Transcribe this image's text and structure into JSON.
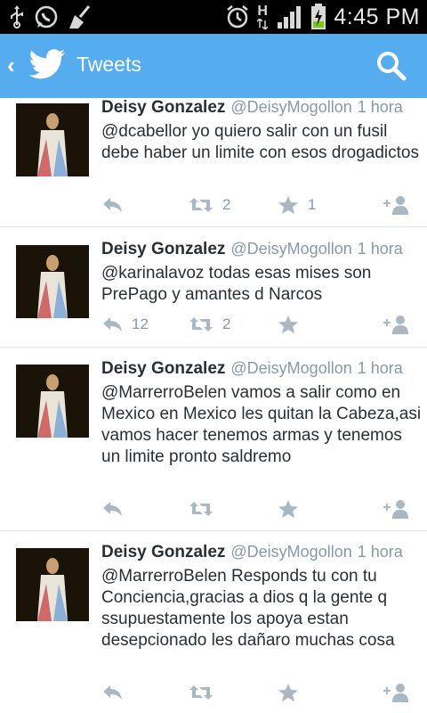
{
  "status_bar": {
    "time": "4:45 PM",
    "network_label": "H",
    "icons": [
      "usb-icon",
      "whatsapp-icon",
      "broom-icon",
      "alarm-icon",
      "signal-icon",
      "battery-icon"
    ]
  },
  "app_bar": {
    "title": "Tweets",
    "icons": [
      "back-arrow-icon",
      "twitter-bird-icon",
      "search-icon"
    ],
    "color": "#55acee"
  },
  "tweets": [
    {
      "name": "Deisy Gonzalez",
      "handle": "@DeisyMogollon",
      "time": "1 hora",
      "text": "@dcabellor yo quiero salir con un fusil debe haber un limite con esos drogadictos",
      "reply_count": "",
      "retweet_count": "2",
      "favorite_count": "1"
    },
    {
      "name": "Deisy Gonzalez",
      "handle": "@DeisyMogollon",
      "time": "1 hora",
      "text": "@karinalavoz todas esas mises son PrePago y amantes d Narcos",
      "reply_count": "12",
      "retweet_count": "2",
      "favorite_count": ""
    },
    {
      "name": "Deisy Gonzalez",
      "handle": "@DeisyMogollon",
      "time": "1 hora",
      "text": "@MarrerroBelen vamos a salir como en Mexico en Mexico les quitan la Cabeza,asi vamos hacer tenemos armas y tenemos un limite pronto saldremo",
      "reply_count": "",
      "retweet_count": "",
      "favorite_count": ""
    },
    {
      "name": "Deisy Gonzalez",
      "handle": "@DeisyMogollon",
      "time": "1 hora",
      "text": "@MarrerroBelen Responds tu con tu Conciencia,gracias a dios q la gente q ssupuestamente los apoya estan desepcionado les dañaro muchas cosa",
      "reply_count": "",
      "retweet_count": "",
      "favorite_count": ""
    }
  ]
}
